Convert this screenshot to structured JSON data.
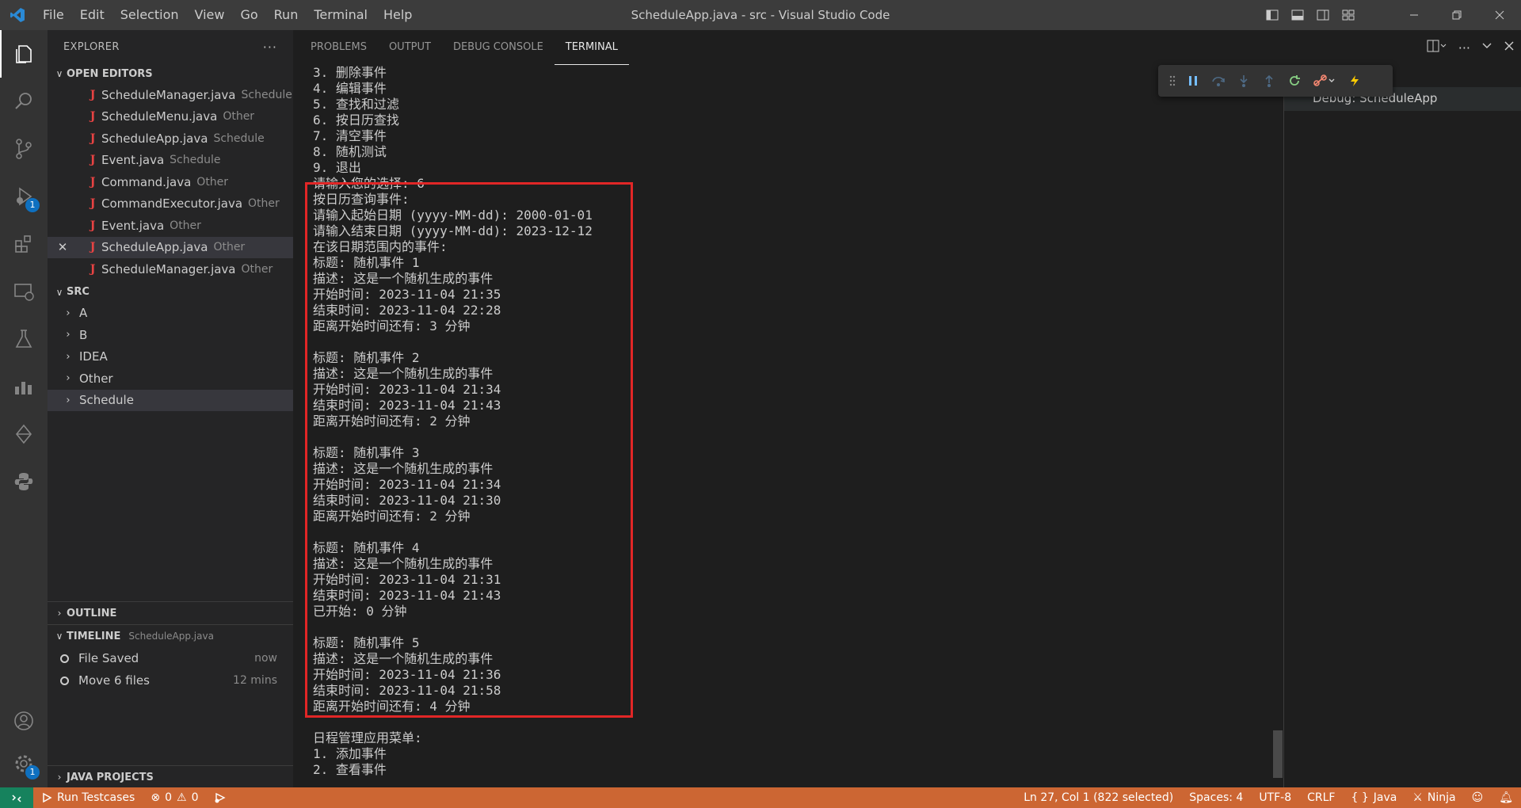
{
  "window": {
    "title": "ScheduleApp.java - src - Visual Studio Code",
    "menu": [
      "File",
      "Edit",
      "Selection",
      "View",
      "Go",
      "Run",
      "Terminal",
      "Help"
    ]
  },
  "activity_bar": {
    "icons": [
      "explorer-icon",
      "search-icon",
      "source-control-icon",
      "run-debug-icon",
      "extensions-icon",
      "remote-explorer-icon",
      "testing-icon",
      "charts-icon",
      "git-lens-icon",
      "python-icon"
    ],
    "debug_badge": "1",
    "accounts_icon": "account-icon",
    "manage_icon": "gear-icon",
    "manage_badge": "1"
  },
  "explorer": {
    "header": "EXPLORER",
    "open_editors_title": "OPEN EDITORS",
    "open_editors": [
      {
        "name": "ScheduleManager.java",
        "desc": "Schedule"
      },
      {
        "name": "ScheduleMenu.java",
        "desc": "Other"
      },
      {
        "name": "ScheduleApp.java",
        "desc": "Schedule"
      },
      {
        "name": "Event.java",
        "desc": "Schedule"
      },
      {
        "name": "Command.java",
        "desc": "Other"
      },
      {
        "name": "CommandExecutor.java",
        "desc": "Other"
      },
      {
        "name": "Event.java",
        "desc": "Other"
      },
      {
        "name": "ScheduleApp.java",
        "desc": "Other"
      },
      {
        "name": "ScheduleManager.java",
        "desc": "Other"
      }
    ],
    "src_title": "SRC",
    "folders": [
      "A",
      "B",
      "IDEA",
      "Other",
      "Schedule"
    ],
    "outline_title": "OUTLINE",
    "timeline_title": "TIMELINE",
    "timeline_file": "ScheduleApp.java",
    "timeline": [
      {
        "label": "File Saved",
        "time": "now"
      },
      {
        "label": "Move 6 files",
        "time": "12 mins"
      }
    ],
    "java_projects_title": "JAVA PROJECTS"
  },
  "panel": {
    "tabs": [
      "PROBLEMS",
      "OUTPUT",
      "DEBUG CONSOLE",
      "TERMINAL"
    ],
    "active_tab": "TERMINAL",
    "session": "Debug: ScheduleApp"
  },
  "terminal_lines": [
    "3. 删除事件",
    "4. 编辑事件",
    "5. 查找和过滤",
    "6. 按日历查找",
    "7. 清空事件",
    "8. 随机测试",
    "9. 退出",
    "请输入您的选择: 6",
    "按日历查询事件:",
    "请输入起始日期 (yyyy-MM-dd): 2000-01-01",
    "请输入结束日期 (yyyy-MM-dd): 2023-12-12",
    "在该日期范围内的事件:",
    "标题: 随机事件 1",
    "描述: 这是一个随机生成的事件",
    "开始时间: 2023-11-04 21:35",
    "结束时间: 2023-11-04 22:28",
    "距离开始时间还有: 3 分钟",
    "",
    "标题: 随机事件 2",
    "描述: 这是一个随机生成的事件",
    "开始时间: 2023-11-04 21:34",
    "结束时间: 2023-11-04 21:43",
    "距离开始时间还有: 2 分钟",
    "",
    "标题: 随机事件 3",
    "描述: 这是一个随机生成的事件",
    "开始时间: 2023-11-04 21:34",
    "结束时间: 2023-11-04 21:30",
    "距离开始时间还有: 2 分钟",
    "",
    "标题: 随机事件 4",
    "描述: 这是一个随机生成的事件",
    "开始时间: 2023-11-04 21:31",
    "结束时间: 2023-11-04 21:43",
    "已开始: 0 分钟",
    "",
    "标题: 随机事件 5",
    "描述: 这是一个随机生成的事件",
    "开始时间: 2023-11-04 21:36",
    "结束时间: 2023-11-04 21:58",
    "距离开始时间还有: 4 分钟",
    "",
    "日程管理应用菜单:",
    "1. 添加事件",
    "2. 查看事件"
  ],
  "status_bar": {
    "run_testcases": "Run Testcases",
    "errors": "0",
    "warnings": "0",
    "cursor": "Ln 27, Col 1 (822 selected)",
    "spaces": "Spaces: 4",
    "encoding": "UTF-8",
    "eol": "CRLF",
    "language": "Java",
    "ninja": "Ninja",
    "bg_color": "#cc6633"
  },
  "colors": {
    "accent": "#0e70c0",
    "highlight_box": "#e12626",
    "java_icon": "#e84343"
  }
}
